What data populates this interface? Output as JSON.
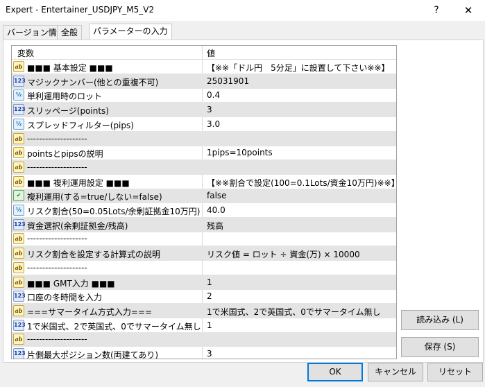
{
  "window": {
    "title": "Expert - Entertainer_USDJPY_M5_V2",
    "help": "?",
    "close": "✕"
  },
  "tabs": [
    "バージョン情報",
    "全般",
    "パラメーターの入力"
  ],
  "grid": {
    "col_variable": "変数",
    "col_value": "値",
    "rows": [
      {
        "icon": "ab",
        "name": "■■■ 基本設定 ■■■",
        "value": "【※※「ドル円　5分足」に設置して下さい※※】"
      },
      {
        "icon": "123",
        "name": "マジックナンバー(他との重複不可)",
        "value": "25031901"
      },
      {
        "icon": "½",
        "name": "単利運用時のロット",
        "value": "0.4"
      },
      {
        "icon": "123",
        "name": "スリッページ(points)",
        "value": "3"
      },
      {
        "icon": "½",
        "name": "スプレッドフィルター(pips)",
        "value": "3.0"
      },
      {
        "icon": "ab",
        "name": "--------------------",
        "value": ""
      },
      {
        "icon": "ab",
        "name": "pointsとpipsの説明",
        "value": "1pips=10points"
      },
      {
        "icon": "ab",
        "name": "--------------------",
        "value": ""
      },
      {
        "icon": "ab",
        "name": "■■■ 複利運用設定 ■■■",
        "value": "【※※割合で設定(100=0.1Lots/資金10万円)※※】"
      },
      {
        "icon": "bool",
        "name": "複利運用(する=true/しない=false)",
        "value": "false"
      },
      {
        "icon": "½",
        "name": "リスク割合(50=0.05Lots/余剰証拠金10万円)",
        "value": "40.0"
      },
      {
        "icon": "123",
        "name": "資金選択(余剰証拠金/残高)",
        "value": "残高"
      },
      {
        "icon": "ab",
        "name": "--------------------",
        "value": ""
      },
      {
        "icon": "ab",
        "name": "リスク割合を設定する計算式の説明",
        "value": "リスク値 = ロット ÷ 資金(万) × 10000"
      },
      {
        "icon": "ab",
        "name": "--------------------",
        "value": ""
      },
      {
        "icon": "ab",
        "name": "■■■ GMT入力 ■■■",
        "value": "1"
      },
      {
        "icon": "123",
        "name": "口座の冬時間を入力",
        "value": "2"
      },
      {
        "icon": "ab",
        "name": "===サマータイム方式入力===",
        "value": "1で米国式、2で英国式、0でサマータイム無し"
      },
      {
        "icon": "123",
        "name": "1で米国式、2で英国式、0でサマータイム無し",
        "value": "1"
      },
      {
        "icon": "ab",
        "name": "--------------------",
        "value": ""
      },
      {
        "icon": "123",
        "name": "片側最大ポジション数(両建てあり)",
        "value": "3"
      }
    ]
  },
  "side_buttons": {
    "load": "読み込み (L)",
    "save": "保存 (S)"
  },
  "buttons": {
    "ok": "OK",
    "cancel": "キャンセル",
    "reset": "リセット"
  }
}
